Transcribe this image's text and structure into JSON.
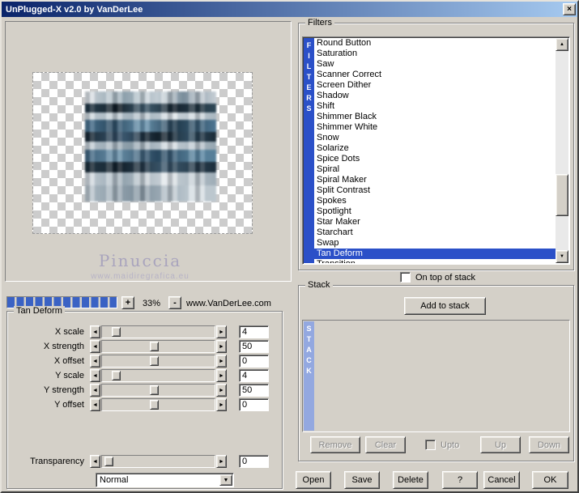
{
  "window": {
    "title": "UnPlugged-X v2.0 by VanDerLee"
  },
  "icons": {
    "close": "×",
    "left_arrow": "◄",
    "right_arrow": "►",
    "up_arrow": "▲",
    "down_arrow": "▼",
    "combo_arrow": "▼"
  },
  "colors": {
    "dialog_bg": "#D4D0C8",
    "titlebar_left": "#0A246A",
    "titlebar_right": "#A6CAF0",
    "selection": "#2B50C8",
    "filters_strip": "#2B50C8",
    "stack_strip": "#93A8E0",
    "progress_fill": "#3A62C4",
    "watermark": "#A9A4BD"
  },
  "preview": {
    "watermark_title": "Pinuccia",
    "watermark_url": "www.maidiregrafica.eu"
  },
  "zoom": {
    "plus": "+",
    "value": "33%",
    "minus": "-",
    "website": "www.VanDerLee.com"
  },
  "params": {
    "group_title": "Tan Deform",
    "sliders": [
      {
        "label": "X scale",
        "value": "4",
        "thumb_pct": 9
      },
      {
        "label": "X strength",
        "value": "50",
        "thumb_pct": 46
      },
      {
        "label": "X offset",
        "value": "0",
        "thumb_pct": 46
      },
      {
        "label": "Y scale",
        "value": "4",
        "thumb_pct": 9
      },
      {
        "label": "Y strength",
        "value": "50",
        "thumb_pct": 46
      },
      {
        "label": "Y offset",
        "value": "0",
        "thumb_pct": 46
      }
    ],
    "transparency": {
      "label": "Transparency",
      "value": "0",
      "thumb_pct": 2
    },
    "blend_mode": "Normal"
  },
  "filters": {
    "group_title": "Filters",
    "vertical_label": "F\nI\nL\nT\nE\nR\nS",
    "items": [
      "Round Button",
      "Saturation",
      "Saw",
      "Scanner Correct",
      "Screen Dither",
      "Shadow",
      "Shift",
      "Shimmer Black",
      "Shimmer White",
      "Snow",
      "Solarize",
      "Spice Dots",
      "Spiral",
      "Spiral Maker",
      "Split Contrast",
      "Spokes",
      "Spotlight",
      "Star Maker",
      "Starchart",
      "Swap",
      "Tan Deform",
      "Transition"
    ],
    "selected": "Tan Deform",
    "on_top_label": "On top of stack",
    "on_top_checked": false
  },
  "stack": {
    "group_title": "Stack",
    "add_button": "Add to stack",
    "vertical_label": "S\nT\nA\nC\nK",
    "buttons": {
      "remove": "Remove",
      "clear": "Clear",
      "upto": "Upto",
      "upto_checked": false,
      "up": "Up",
      "down": "Down"
    }
  },
  "actions": {
    "open": "Open",
    "save": "Save",
    "delete": "Delete",
    "help": "?",
    "cancel": "Cancel",
    "ok": "OK"
  }
}
